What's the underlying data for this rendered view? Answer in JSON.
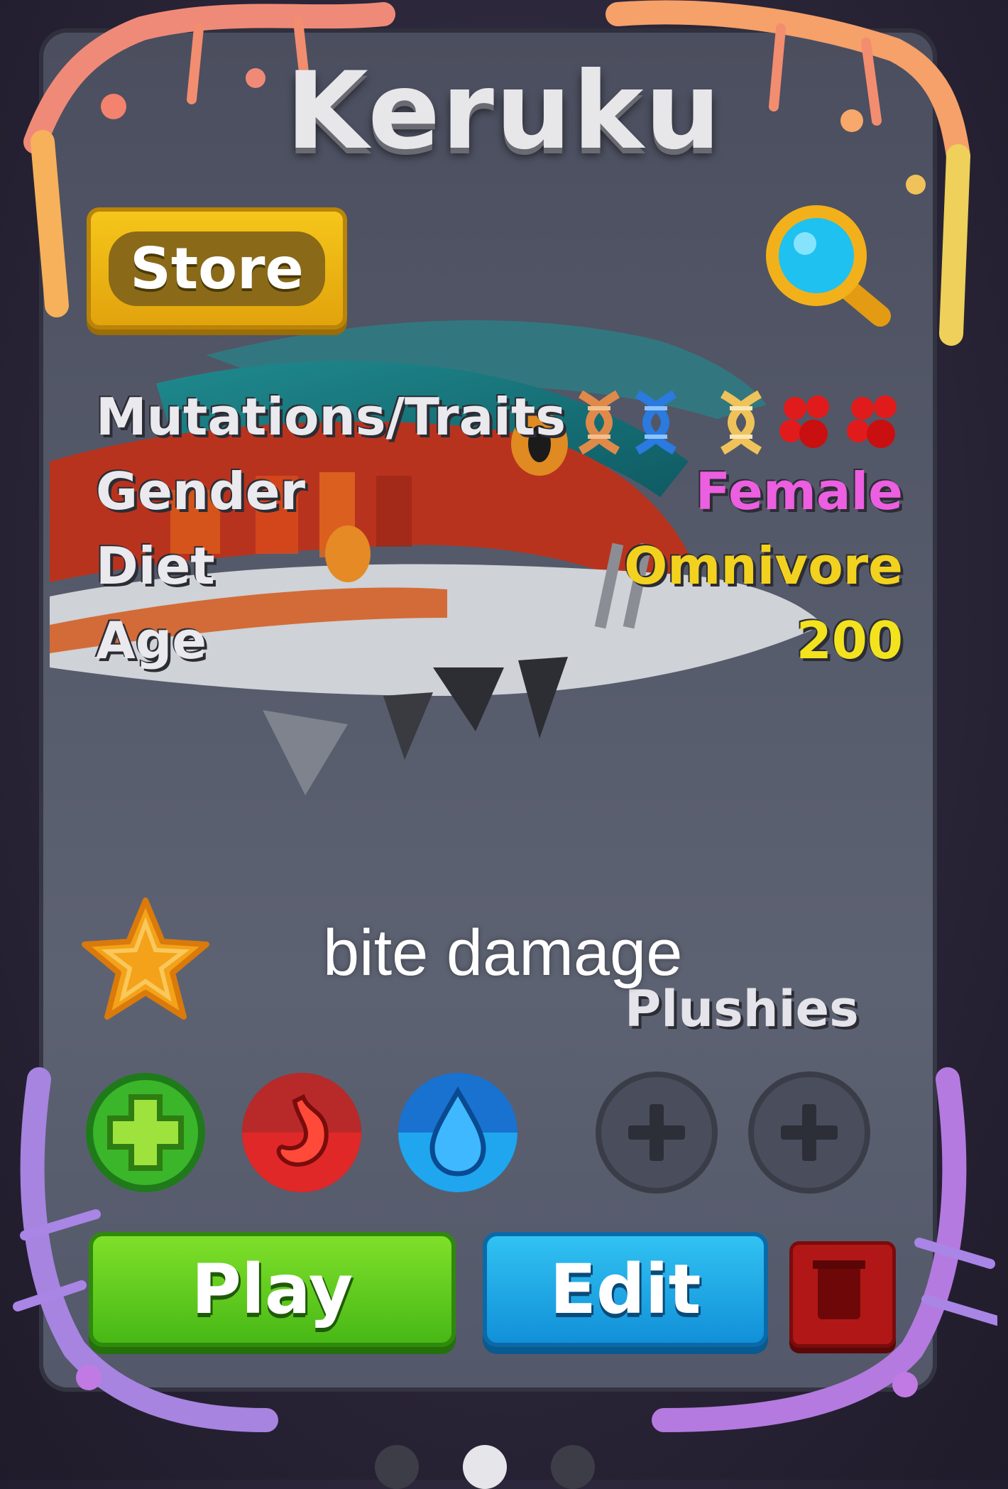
{
  "card": {
    "title": "Keruku"
  },
  "store": {
    "label": "Store"
  },
  "stats": {
    "traits_label": "Mutations/Traits",
    "gender_label": "Gender",
    "gender_value": "Female",
    "diet_label": "Diet",
    "diet_value": "Omnivore",
    "age_label": "Age",
    "age_value": "200",
    "trait_icons": [
      "dna-orange-icon",
      "dna-blue-icon",
      "dna-gold-icon",
      "paw-red-icon",
      "paw-red-icon"
    ]
  },
  "caption": {
    "text": "bite damage"
  },
  "plushies": {
    "label": "Plushies",
    "slots": [
      "add-plushie-icon",
      "add-plushie-icon"
    ]
  },
  "status_icons": [
    "health-plus-icon",
    "stomach-icon",
    "water-drop-icon"
  ],
  "actions": {
    "play_label": "Play",
    "edit_label": "Edit"
  },
  "colors": {
    "gender": "#ec5fe0",
    "diet": "#f3d21f",
    "age": "#f3e31f",
    "play": "#57c41b",
    "edit": "#1aa7e6",
    "store": "#f0b80f"
  },
  "pager": {
    "pages": 3,
    "active": 2
  }
}
